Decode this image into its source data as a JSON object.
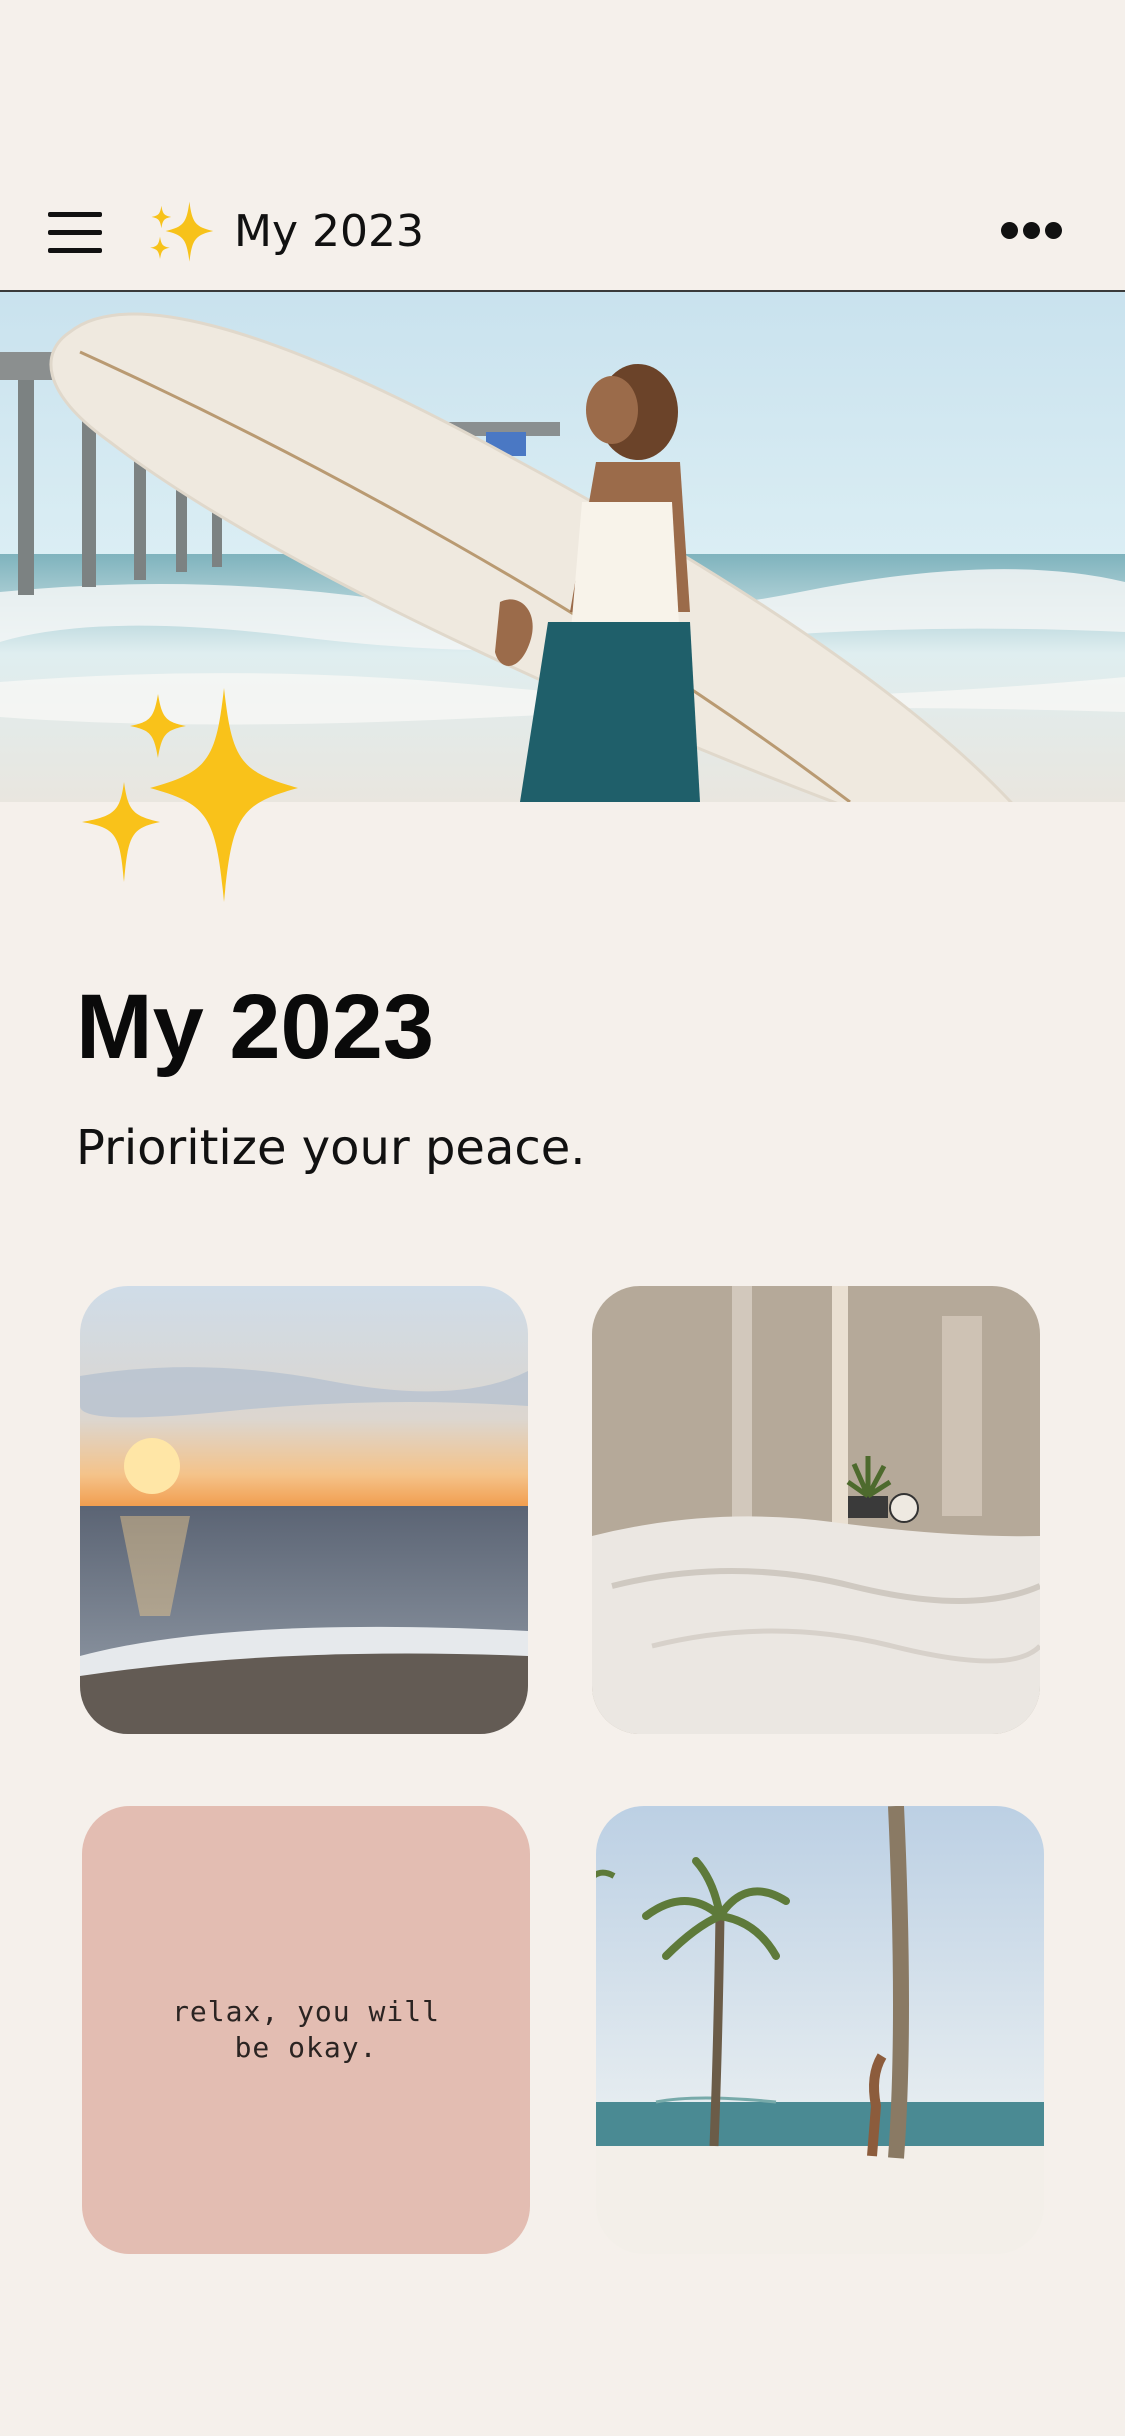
{
  "header": {
    "title": "My 2023",
    "menu_icon": "hamburger-menu-icon",
    "title_icon": "sparkles-icon",
    "more_icon": "more-horizontal-icon"
  },
  "hero": {
    "image": "woman-carrying-surfboard-on-beach"
  },
  "main": {
    "decoration_icon": "sparkles-icon",
    "title": "My 2023",
    "subtitle": "Prioritize your peace."
  },
  "tiles": [
    {
      "type": "image",
      "image": "ocean-sunset-beach"
    },
    {
      "type": "image",
      "image": "bedroom-white-sheets-plant"
    },
    {
      "type": "text",
      "text": "relax, you will be okay.",
      "background": "#e3bdb2"
    },
    {
      "type": "image",
      "image": "palm-trees-beach"
    }
  ],
  "colors": {
    "background": "#f5f0eb",
    "accent_gold": "#f5c518",
    "quote_tile": "#e3bdb2"
  }
}
